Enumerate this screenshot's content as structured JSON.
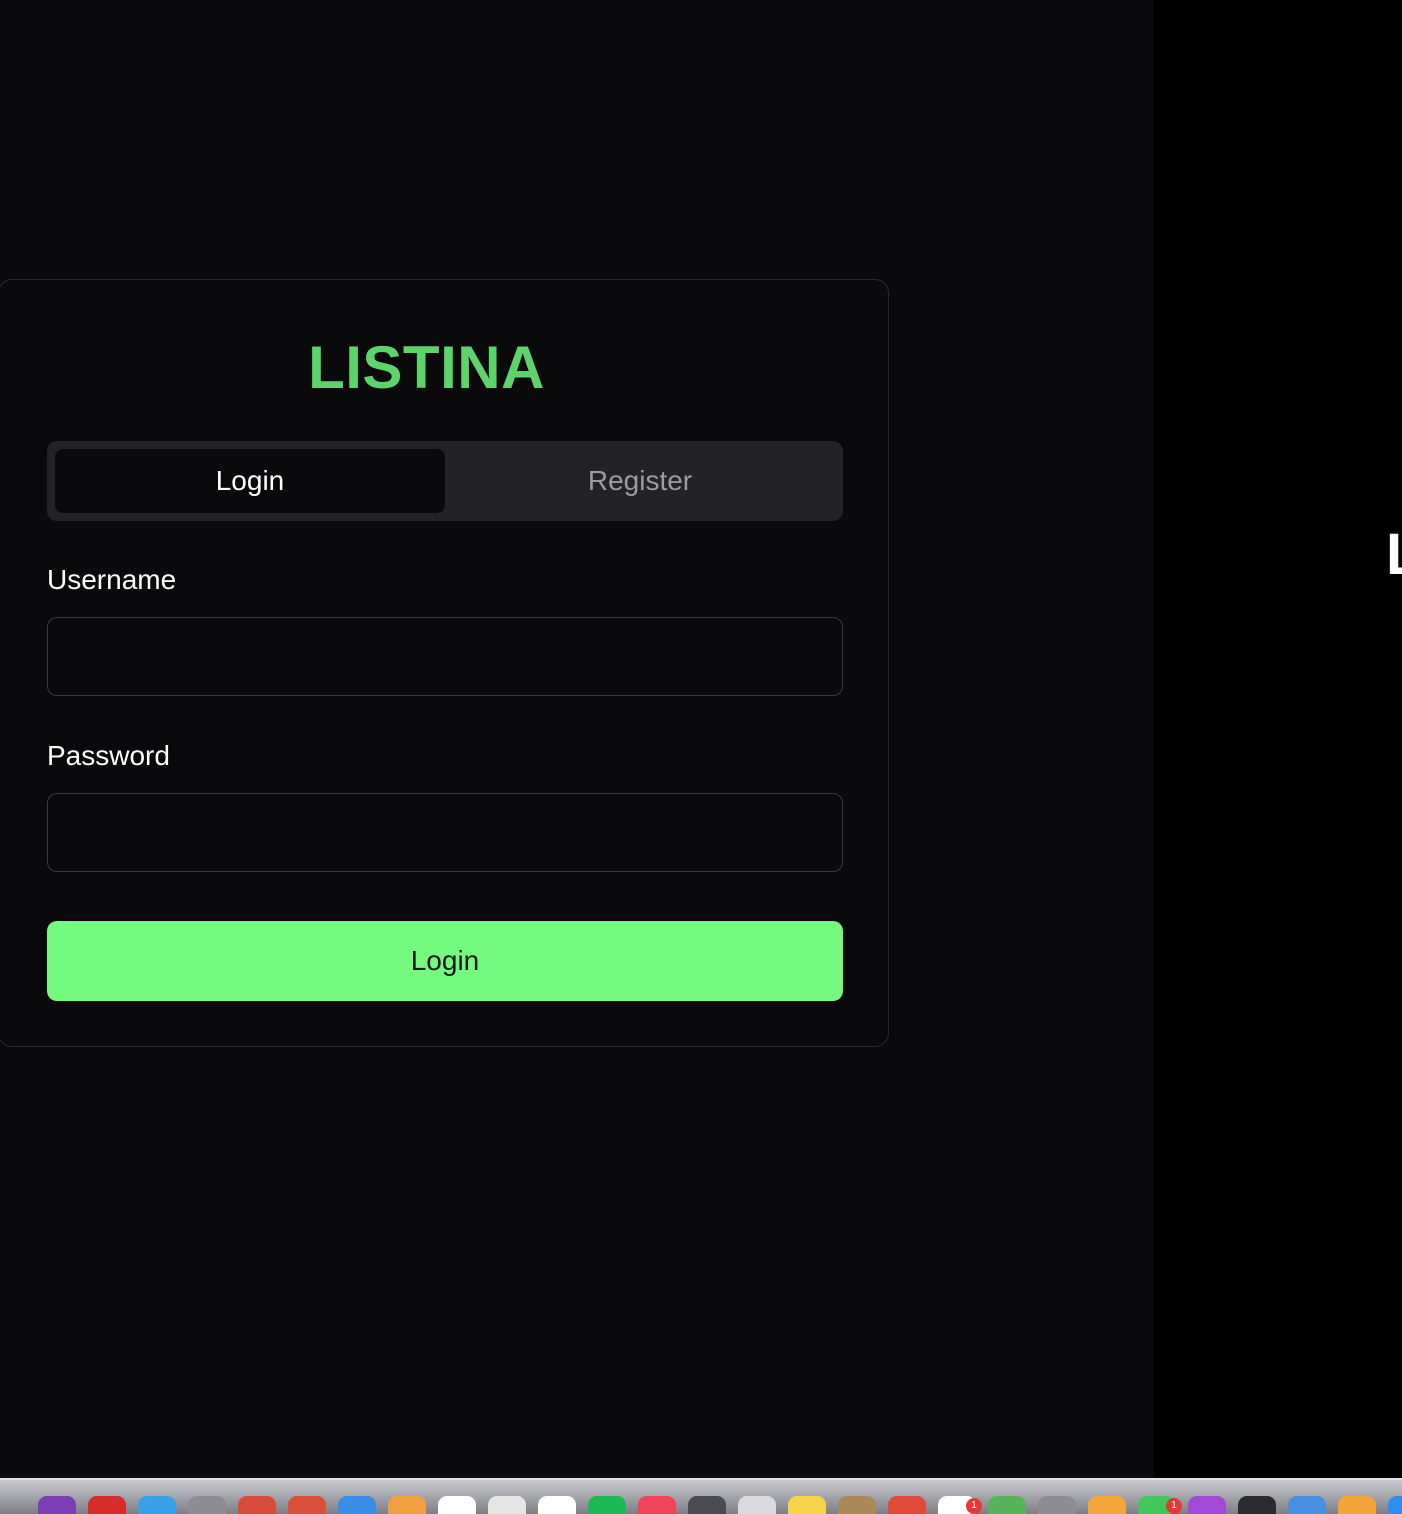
{
  "app": {
    "brand": "LISTINA",
    "brand_color": "#5dd46a",
    "accent_color": "#74fa7e"
  },
  "tabs": [
    {
      "label": "Login",
      "active": true
    },
    {
      "label": "Register",
      "active": false
    }
  ],
  "form": {
    "username_label": "Username",
    "username_value": "",
    "password_label": "Password",
    "password_value": "",
    "submit_label": "Login"
  },
  "right_panel": {
    "clipped_text": "L"
  },
  "dock": {
    "icons": [
      {
        "name": "podcast-icon",
        "color": "#7b3fb5"
      },
      {
        "name": "opera-icon",
        "color": "#d62c2c"
      },
      {
        "name": "finder-icon",
        "color": "#3aa0e8"
      },
      {
        "name": "search-icon",
        "color": "#8c8c92"
      },
      {
        "name": "calendar-app-icon",
        "color": "#d84a3a"
      },
      {
        "name": "red-app-icon",
        "color": "#d94f3c"
      },
      {
        "name": "safari-icon",
        "color": "#3a8ee8"
      },
      {
        "name": "photos-icon",
        "color": "#f0a040"
      },
      {
        "name": "notes-icon",
        "color": "#ffffff"
      },
      {
        "name": "activity-monitor-icon",
        "color": "#e6e6e6"
      },
      {
        "name": "home-icon",
        "color": "#ffffff"
      },
      {
        "name": "spotify-icon",
        "color": "#1db954"
      },
      {
        "name": "music-icon",
        "color": "#f0445a"
      },
      {
        "name": "settings-icon",
        "color": "#4a4a52"
      },
      {
        "name": "pencil-icon",
        "color": "#d9d9de"
      },
      {
        "name": "stickies-icon",
        "color": "#f5d34a"
      },
      {
        "name": "archive-icon",
        "color": "#a8895a"
      },
      {
        "name": "calendar-icon",
        "color": "#e04a3a"
      },
      {
        "name": "mail-icon",
        "color": "#ffffff"
      },
      {
        "name": "maps-icon",
        "color": "#58b45a"
      },
      {
        "name": "magnifier-icon",
        "color": "#8c8c92"
      },
      {
        "name": "orange-app-icon",
        "color": "#f3a43a"
      },
      {
        "name": "messages-icon",
        "color": "#43c75a"
      },
      {
        "name": "podcasts-icon",
        "color": "#a14ad8"
      },
      {
        "name": "terminal-icon",
        "color": "#2b2b2e"
      },
      {
        "name": "blue-app-icon",
        "color": "#4a90e2"
      },
      {
        "name": "orange-folder-icon",
        "color": "#f2a33a"
      },
      {
        "name": "blue-tool-icon",
        "color": "#2d8ef0"
      }
    ],
    "badges": [
      {
        "icon_index": 18,
        "count": "1"
      },
      {
        "icon_index": 22,
        "count": "1"
      }
    ]
  }
}
